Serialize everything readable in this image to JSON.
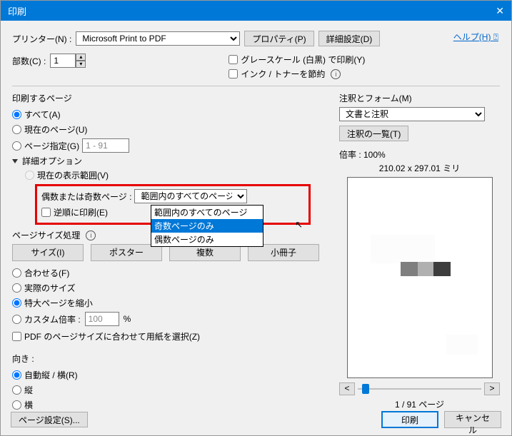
{
  "title": "印刷",
  "printer_label": "プリンター(N) :",
  "printer_value": "Microsoft Print to PDF",
  "btn_properties": "プロパティ(P)",
  "btn_advanced": "詳細設定(D)",
  "help_link": "ヘルプ(H)",
  "help_icon": "⍰",
  "copies_label": "部数(C) :",
  "copies_value": "1",
  "grayscale_label": "グレースケール (白黒) で印刷(Y)",
  "savetoner_label": "インク / トナーを節約",
  "range": {
    "title": "印刷するページ",
    "all": "すべて(A)",
    "current": "現在のページ(U)",
    "pages": "ページ指定(G)",
    "pages_value": "1 - 91",
    "more": "詳細オプション",
    "currentview": "現在の表示範囲(V)",
    "oddeven_label": "偶数または奇数ページ :",
    "oddeven_selected": "範囲内のすべてのページ",
    "dropdown": {
      "opt1": "範囲内のすべてのページ",
      "opt2": "奇数ページのみ",
      "opt3": "偶数ページのみ"
    },
    "reverse": "逆順に印刷(E)"
  },
  "sizing": {
    "title": "ページサイズ処理",
    "btn_size": "サイズ(I)",
    "btn_poster": "ポスター",
    "btn_multi": "複数",
    "btn_booklet": "小冊子",
    "fit": "合わせる(F)",
    "actual": "実際のサイズ",
    "shrink": "特大ページを縮小",
    "custom": "カスタム倍率 :",
    "custom_value": "100",
    "custom_pct": "%",
    "pdf_pagesize": "PDF のページサイズに合わせて用紙を選択(Z)"
  },
  "orient": {
    "title": "向き :",
    "auto": "自動縦 / 横(R)",
    "portrait": "縦",
    "landscape": "横"
  },
  "anno": {
    "title": "注釈とフォーム(M)",
    "value": "文書と注釈",
    "btn_list": "注釈の一覧(T)"
  },
  "preview": {
    "scale_label": "倍率 : 100%",
    "dims": "210.02 x 297.01 ミリ",
    "nav_prev": "<",
    "nav_next": ">",
    "page_of": "1 / 91 ページ"
  },
  "footer": {
    "page_setup": "ページ設定(S)...",
    "print": "印刷",
    "cancel": "キャンセル"
  }
}
